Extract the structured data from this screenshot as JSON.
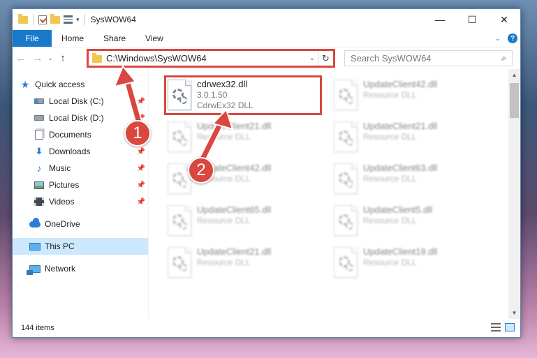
{
  "window": {
    "title": "SysWOW64",
    "controls": {
      "minimize": "—",
      "maximize": "☐",
      "close": "✕"
    }
  },
  "ribbon": {
    "tabs": [
      {
        "label": "File",
        "active": true
      },
      {
        "label": "Home"
      },
      {
        "label": "Share"
      },
      {
        "label": "View"
      }
    ],
    "help": "?",
    "collapse": "⌄"
  },
  "nav": {
    "back": "←",
    "forward": "→",
    "recent": "⌄",
    "up": "↑",
    "address": "C:\\Windows\\SysWOW64",
    "address_dropdown": "⌄",
    "refresh": "↻",
    "search_placeholder": "Search SysWOW64",
    "search_icon": "⌕"
  },
  "sidebar": {
    "items": [
      {
        "label": "Quick access",
        "icon": "star-icon",
        "pinned": false
      },
      {
        "label": "Local Disk (C:)",
        "icon": "disk-c-icon",
        "pinned": true
      },
      {
        "label": "Local Disk (D:)",
        "icon": "disk-icon",
        "pinned": true
      },
      {
        "label": "Documents",
        "icon": "documents-icon",
        "pinned": true
      },
      {
        "label": "Downloads",
        "icon": "downloads-icon",
        "pinned": true
      },
      {
        "label": "Music",
        "icon": "music-icon",
        "pinned": true
      },
      {
        "label": "Pictures",
        "icon": "pictures-icon",
        "pinned": true
      },
      {
        "label": "Videos",
        "icon": "videos-icon",
        "pinned": true
      },
      {
        "label": "OneDrive",
        "icon": "onedrive-icon"
      },
      {
        "label": "This PC",
        "icon": "this-pc-icon",
        "selected": true
      },
      {
        "label": "Network",
        "icon": "network-icon"
      }
    ]
  },
  "files": [
    {
      "name": "cdrwex32.dll",
      "line2": "3.0.1.50",
      "line3": "CdrwEx32 DLL",
      "highlighted": true
    },
    {
      "name": "UpdateClient42.dll",
      "line2": "Resource DLL",
      "blurred": true
    },
    {
      "name": "UpdateClient21.dll",
      "line2": "Resource DLL",
      "blurred": true
    },
    {
      "name": "UpdateClient21.dll",
      "line2": "Resource DLL",
      "blurred": true
    },
    {
      "name": "UpdateClient42.dll",
      "line2": "Resource DLL",
      "blurred": true
    },
    {
      "name": "UpdateClient63.dll",
      "line2": "Resource DLL",
      "blurred": true
    },
    {
      "name": "UpdateClient65.dll",
      "line2": "Resource DLL",
      "blurred": true
    },
    {
      "name": "UpdateClient5.dll",
      "line2": "Resource DLL",
      "blurred": true
    },
    {
      "name": "UpdateClient21.dll",
      "line2": "Resource DLL",
      "blurred": true
    },
    {
      "name": "UpdateClient19.dll",
      "line2": "Resource DLL",
      "blurred": true
    }
  ],
  "status": {
    "item_count": "144 items"
  },
  "callouts": [
    {
      "number": "1"
    },
    {
      "number": "2"
    }
  ],
  "colors": {
    "accent": "#1979ca",
    "highlight": "#d9473f",
    "selection": "#cce8ff"
  }
}
